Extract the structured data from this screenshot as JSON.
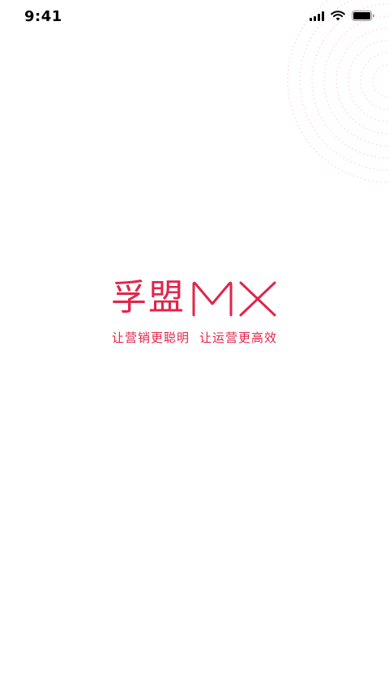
{
  "status_bar": {
    "time": "9:41",
    "icons": [
      "signal-icon",
      "wifi-icon",
      "battery-icon"
    ]
  },
  "splash": {
    "brand_cn": "孚盟",
    "brand_latin": "MX",
    "tagline_part1": "让营销更聪明",
    "tagline_part2": "让运营更高效"
  },
  "colors": {
    "accent": "#e0254b",
    "background": "#ffffff",
    "decor_ring": "#f6d6dc"
  }
}
